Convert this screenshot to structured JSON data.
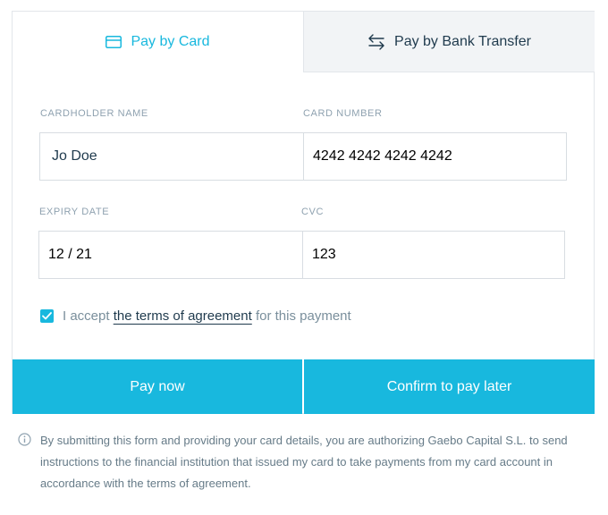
{
  "tabs": {
    "card_label": "Pay by Card",
    "bank_label": "Pay by Bank Transfer"
  },
  "form": {
    "cardholder_label": "CARDHOLDER NAME",
    "cardholder_value": "Jo Doe",
    "card_number_label": "CARD NUMBER",
    "card_number_value": "4242 4242 4242 4242",
    "expiry_label": "EXPIRY DATE",
    "expiry_value": "12 / 21",
    "cvc_label": "CVC",
    "cvc_value": "123"
  },
  "agreement": {
    "checked": true,
    "prefix": "I accept",
    "link_text": "the terms of agreement",
    "suffix": "for this payment"
  },
  "buttons": {
    "pay_now": "Pay now",
    "pay_later": "Confirm to pay later"
  },
  "notice": "By submitting this form and providing your card details, you are authorizing Gaebo Capital S.L. to send instructions to the financial institution that issued my card to take payments from my card account in accordance with the terms of agreement.",
  "colors": {
    "accent": "#18b8de",
    "text": "#1f3a4d",
    "muted": "#8fa2b0",
    "inactive_tab_bg": "#f2f4f6"
  }
}
